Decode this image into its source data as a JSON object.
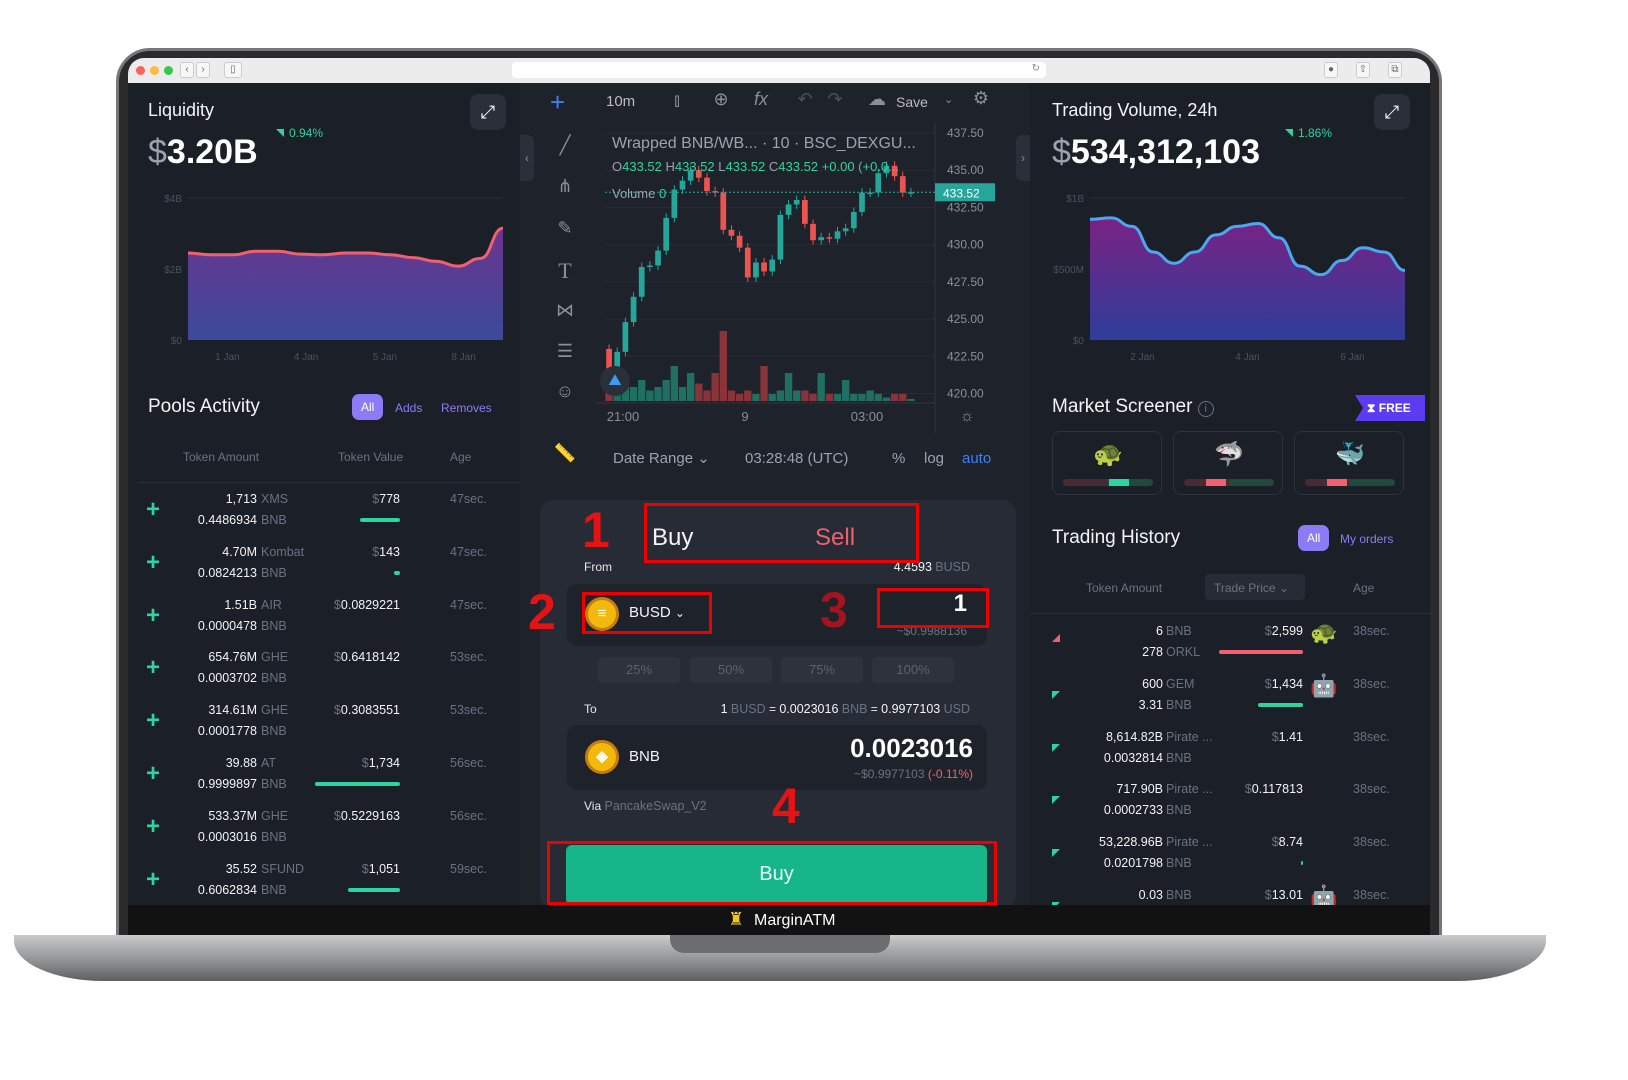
{
  "brand": {
    "name": "MarginATM",
    "accent": "#16b688",
    "purple": "#8b7cf6",
    "red": "#f0616d",
    "green": "#2dd4a0"
  },
  "liquidity": {
    "title": "Liquidity",
    "currency": "$",
    "value": "3.20B",
    "change": "0.94%",
    "expand_icon": "expand-icon"
  },
  "volume": {
    "title": "Trading Volume, 24h",
    "currency": "$",
    "value": "534,312,103",
    "change": "1.86%",
    "expand_icon": "expand-icon"
  },
  "chart_data": [
    {
      "type": "area",
      "y_ticks": [
        "$0",
        "$2B",
        "$4B"
      ],
      "ylim": [
        0,
        4
      ],
      "x_ticks": [
        "1 Jan",
        "4 Jan",
        "5 Jan",
        "8 Jan"
      ],
      "values": [
        2.45,
        2.4,
        2.4,
        2.5,
        2.5,
        2.42,
        2.4,
        2.45,
        2.45,
        2.4,
        2.32,
        2.22,
        2.08,
        2.3,
        3.15
      ],
      "unit": "B",
      "line_color": "#f0616d",
      "grid": true
    },
    {
      "type": "area",
      "y_ticks": [
        "$0",
        "$500M",
        "$1B"
      ],
      "ylim": [
        0,
        1
      ],
      "x_ticks": [
        "2 Jan",
        "4 Jan",
        "6 Jan"
      ],
      "values": [
        0.85,
        0.86,
        0.8,
        0.62,
        0.54,
        0.62,
        0.74,
        0.8,
        0.82,
        0.72,
        0.52,
        0.46,
        0.56,
        0.65,
        0.62,
        0.49
      ],
      "line_color": "#4aa8f0",
      "grid": true
    },
    {
      "type": "candlestick",
      "title": "Wrapped BNB/WB...",
      "interval": "10",
      "exchange": "BSC_DEXGU...",
      "ohlc_label": {
        "o": "433.52",
        "h": "433.52",
        "l": "433.52",
        "c": "433.52",
        "chg": "+0.00 (+0.0..."
      },
      "volume_label": "Volume",
      "volume_value": "0",
      "last_price": "433.52",
      "y_ticks": [
        "437.50",
        "435.00",
        "432.50",
        "430.00",
        "427.50",
        "425.00",
        "422.50",
        "420.00"
      ],
      "ylim": [
        419.5,
        437.5
      ],
      "x_ticks": [
        "21:00",
        "9",
        "03:00"
      ],
      "closes": [
        421.6,
        422.8,
        424.8,
        426.5,
        428.5,
        428.6,
        429.6,
        431.8,
        433.7,
        434.3,
        435.0,
        434.5,
        433.6,
        433.5,
        431.0,
        430.6,
        429.8,
        427.8,
        428.8,
        428.2,
        429.0,
        432.0,
        432.7,
        433.0,
        431.4,
        430.3,
        430.5,
        430.4,
        430.9,
        431.1,
        432.2,
        433.5,
        433.5,
        434.8,
        435.3,
        434.6,
        433.5,
        433.52
      ],
      "first_open": 423.0,
      "volumes": [
        3,
        1.5,
        2,
        2,
        3,
        1.5,
        2,
        3,
        5,
        2,
        4,
        2.5,
        1.5,
        4,
        10,
        1.5,
        1,
        1.5,
        1,
        5,
        1,
        1.5,
        4,
        1.5,
        1.5,
        1,
        4,
        1,
        1,
        3,
        1,
        1,
        1.5,
        1,
        0.5,
        1,
        1,
        0.3
      ]
    }
  ],
  "chart_toolbar": {
    "interval": "10m",
    "save": "Save",
    "date_range": "Date Range",
    "time": "03:28:48 (UTC)",
    "percent": "%",
    "log": "log",
    "auto": "auto"
  },
  "pools": {
    "title": "Pools Activity",
    "tabs": [
      "All",
      "Adds",
      "Removes"
    ],
    "headers": [
      "Token Amount",
      "Token Value",
      "Age"
    ],
    "rows": [
      {
        "a1": "1,713",
        "s1": "XMS",
        "a2": "0.4486934",
        "s2": "BNB",
        "value": "778",
        "bar": 0.44,
        "age": "47sec."
      },
      {
        "a1": "4.70M",
        "s1": "Kombat",
        "a2": "0.0824213",
        "s2": "BNB",
        "value": "143",
        "bar": 0.06,
        "age": "47sec."
      },
      {
        "a1": "1.51B",
        "s1": "AIR",
        "a2": "0.0000478",
        "s2": "BNB",
        "value": "0.0829221",
        "bar": 0,
        "age": "47sec."
      },
      {
        "a1": "654.76M",
        "s1": "GHE",
        "a2": "0.0003702",
        "s2": "BNB",
        "value": "0.6418142",
        "bar": 0,
        "age": "53sec."
      },
      {
        "a1": "314.61M",
        "s1": "GHE",
        "a2": "0.0001778",
        "s2": "BNB",
        "value": "0.3083551",
        "bar": 0,
        "age": "53sec."
      },
      {
        "a1": "39.88",
        "s1": "AT",
        "a2": "0.9999897",
        "s2": "BNB",
        "value": "1,734",
        "bar": 0.95,
        "age": "56sec."
      },
      {
        "a1": "533.37M",
        "s1": "GHE",
        "a2": "0.0003016",
        "s2": "BNB",
        "value": "0.5229163",
        "bar": 0,
        "age": "56sec."
      },
      {
        "a1": "35.52",
        "s1": "SFUND",
        "a2": "0.6062834",
        "s2": "BNB",
        "value": "1,051",
        "bar": 0.58,
        "age": "59sec."
      }
    ]
  },
  "swap": {
    "tab_buy": "Buy",
    "tab_sell": "Sell",
    "from_label": "From",
    "balance": "4.4593",
    "balance_unit": "BUSD",
    "from_token": "BUSD",
    "from_amount": "1",
    "from_usd": "~$0.9988136",
    "percents": [
      "25%",
      "50%",
      "75%",
      "100%"
    ],
    "to_label": "To",
    "rate": {
      "a": "1",
      "au": "BUSD",
      "b": "0.0023016",
      "bu": "BNB",
      "c": "0.9977103",
      "cu": "USD"
    },
    "to_token": "BNB",
    "to_amount": "0.0023016",
    "to_usd": "~$0.9977103",
    "to_impact": "(-0.11%)",
    "via_label": "Via",
    "via": "PancakeSwap_V2",
    "buy_button": "Buy"
  },
  "annotations": [
    "1",
    "2",
    "3",
    "4"
  ],
  "screener": {
    "title": "Market Screener",
    "badge": "FREE",
    "cards": [
      {
        "icon": "turtle-icon",
        "glyph": "🐢",
        "red": 0.5,
        "mark": "green"
      },
      {
        "icon": "shark-icon",
        "glyph": "🦈",
        "red": 0.5,
        "mark": "red"
      },
      {
        "icon": "whale-icon",
        "glyph": "🐳",
        "red": 0.5,
        "mark": "red"
      }
    ]
  },
  "history": {
    "title": "Trading History",
    "tabs": [
      "All",
      "My orders"
    ],
    "headers": [
      "Token Amount",
      "Trade Price",
      "Age"
    ],
    "rows": [
      {
        "dir": "sell",
        "a1": "6",
        "s1": "BNB",
        "a2": "278",
        "s2": "ORKL",
        "price": "2,599",
        "bar": 0.65,
        "barColor": "#f0616d",
        "icon": "🐢",
        "iconName": "turtle-icon",
        "age": "38sec."
      },
      {
        "dir": "buy",
        "a1": "600",
        "s1": "GEM",
        "a2": "3.31",
        "s2": "BNB",
        "price": "1,434",
        "bar": 0.35,
        "barColor": "#2dd4a0",
        "icon": "🤖",
        "iconName": "robot-icon",
        "age": "38sec."
      },
      {
        "dir": "buy",
        "a1": "8,614.82B",
        "s1": "Pirate ...",
        "a2": "0.0032814",
        "s2": "BNB",
        "price": "1.41",
        "bar": 0,
        "age": "38sec."
      },
      {
        "dir": "buy",
        "a1": "717.90B",
        "s1": "Pirate ...",
        "a2": "0.0002733",
        "s2": "BNB",
        "price": "0.117813",
        "bar": 0,
        "age": "38sec."
      },
      {
        "dir": "buy",
        "a1": "53,228.96B",
        "s1": "Pirate ...",
        "a2": "0.0201798",
        "s2": "BNB",
        "price": "8.74",
        "bar": 0.01,
        "barColor": "#2dd4a0",
        "age": "38sec."
      },
      {
        "dir": "buy",
        "a1": "0.03",
        "s1": "BNB",
        "a2": "",
        "s2": "",
        "price": "13.01",
        "bar": 0,
        "icon": "🤖",
        "iconName": "robot-icon",
        "age": "38sec."
      }
    ]
  }
}
